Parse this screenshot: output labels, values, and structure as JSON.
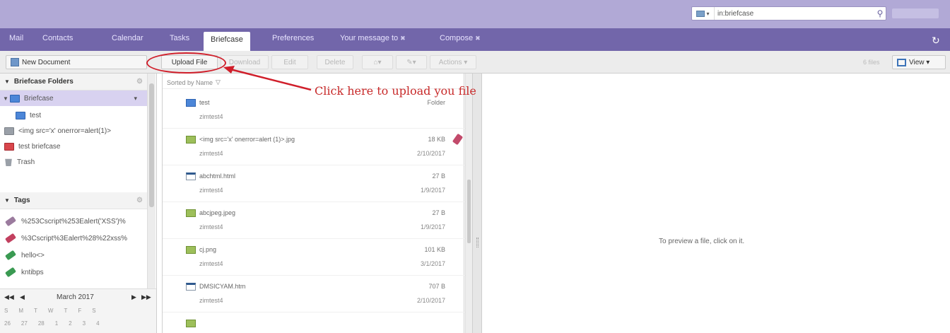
{
  "search": {
    "placeholder": "",
    "value": "in:briefcase"
  },
  "nav": {
    "tabs": [
      {
        "label": "Mail"
      },
      {
        "label": "Contacts"
      },
      {
        "label": "Calendar"
      },
      {
        "label": "Tasks"
      },
      {
        "label": "Briefcase"
      },
      {
        "label": "Preferences"
      },
      {
        "label": "Your message to"
      },
      {
        "label": "Compose"
      }
    ],
    "active_tab": "Briefcase"
  },
  "toolbar": {
    "new_document": "New Document",
    "upload_file": "Upload File",
    "download": "Download",
    "edit": "Edit",
    "delete": "Delete",
    "actions": "Actions",
    "item_count": "6 files",
    "view": "View"
  },
  "callout": {
    "text": "Click here to upload you file",
    "color": "#c82a2a"
  },
  "sidebar": {
    "folders_header": "Briefcase Folders",
    "folders": [
      {
        "label": "Briefcase",
        "icon": "folder-blue-icon",
        "selected": true
      },
      {
        "label": "test",
        "icon": "folder-blue-icon"
      },
      {
        "label": "<img src='x' onerror=alert(1)>",
        "icon": "folder-gray-icon"
      },
      {
        "label": "test briefcase",
        "icon": "folder-red-icon"
      },
      {
        "label": "Trash",
        "icon": "trash-icon"
      }
    ],
    "tags_header": "Tags",
    "tags": [
      {
        "label": "%253Cscript%253Ealert('XSS')%",
        "color": "#9b7b9e"
      },
      {
        "label": "%3Cscript%3Ealert%28%22xss%",
        "color": "#c2405f"
      },
      {
        "label": "hello<>",
        "color": "#3a9a52"
      },
      {
        "label": "kntibps",
        "color": "#3a9a52"
      }
    ]
  },
  "calendar": {
    "month": "March 2017",
    "weekdays": [
      "S",
      "M",
      "T",
      "W",
      "T",
      "F",
      "S"
    ],
    "dates": [
      "26",
      "27",
      "28",
      "1",
      "2",
      "3",
      "4"
    ]
  },
  "list": {
    "sort_label": "Sorted by Name",
    "rows": [
      {
        "name": "test",
        "owner": "zimtest4",
        "size": "Folder",
        "date": "",
        "type": "folder",
        "tagged": false
      },
      {
        "name": "<img src='x' onerror=alert (1)>.jpg",
        "owner": "zimtest4",
        "size": "18 KB",
        "date": "2/10/2017",
        "type": "img",
        "tagged": true
      },
      {
        "name": "abchtml.html",
        "owner": "zimtest4",
        "size": "27 B",
        "date": "1/9/2017",
        "type": "html",
        "tagged": false
      },
      {
        "name": "abcjpeg.jpeg",
        "owner": "zimtest4",
        "size": "27 B",
        "date": "1/9/2017",
        "type": "img",
        "tagged": false
      },
      {
        "name": "cj.png",
        "owner": "zimtest4",
        "size": "101 KB",
        "date": "3/1/2017",
        "type": "img",
        "tagged": false
      },
      {
        "name": "DMSICYAM.htm",
        "owner": "zimtest4",
        "size": "707 B",
        "date": "2/10/2017",
        "type": "html",
        "tagged": false
      },
      {
        "name": "",
        "owner": "",
        "size": "",
        "date": "",
        "type": "img",
        "tagged": false
      }
    ]
  },
  "preview": {
    "message": "To preview a file, click on it."
  }
}
